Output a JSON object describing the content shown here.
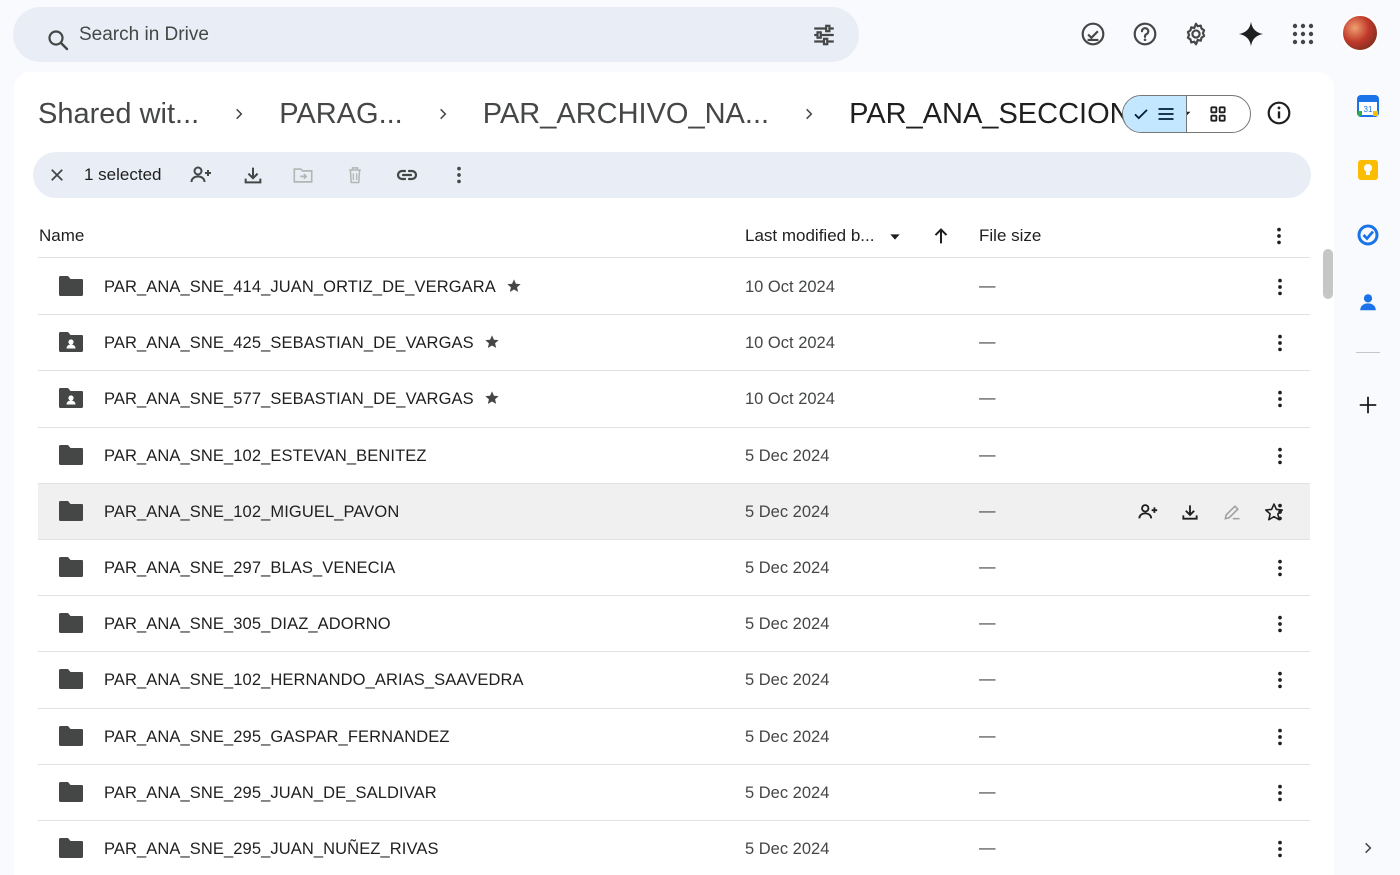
{
  "search": {
    "placeholder": "Search in Drive"
  },
  "top_icons": [
    "ready-for-offline-icon",
    "help-icon",
    "settings-icon",
    "gemini-spark-icon",
    "apps-grid-icon"
  ],
  "breadcrumb": [
    {
      "label": "Shared wit..."
    },
    {
      "label": "PARAG..."
    },
    {
      "label": "PAR_ARCHIVO_NA..."
    },
    {
      "label": "PAR_ANA_SECCION_..."
    }
  ],
  "view_toggle": {
    "selected": "list"
  },
  "selection_bar": {
    "count_label": "1 selected"
  },
  "table": {
    "headers": {
      "name": "Name",
      "modified": "Last modified b...",
      "size": "File size"
    },
    "rows": [
      {
        "name": "PAR_ANA_SNE_414_JUAN_ORTIZ_DE_VERGARA",
        "modified": "10 Oct 2024",
        "size": "—",
        "starred": true,
        "icon": "folder-icon"
      },
      {
        "name": "PAR_ANA_SNE_425_SEBASTIAN_DE_VARGAS",
        "modified": "10 Oct 2024",
        "size": "—",
        "starred": true,
        "icon": "shared-folder-icon"
      },
      {
        "name": "PAR_ANA_SNE_577_SEBASTIAN_DE_VARGAS",
        "modified": "10 Oct 2024",
        "size": "—",
        "starred": true,
        "icon": "shared-folder-icon"
      },
      {
        "name": "PAR_ANA_SNE_102_ESTEVAN_BENITEZ",
        "modified": "5 Dec 2024",
        "size": "—",
        "starred": false,
        "icon": "folder-icon"
      },
      {
        "name": "PAR_ANA_SNE_102_MIGUEL_PAVON",
        "modified": "5 Dec 2024",
        "size": "—",
        "starred": false,
        "icon": "folder-icon",
        "hovered": true
      },
      {
        "name": "PAR_ANA_SNE_297_BLAS_VENECIA",
        "modified": "5 Dec 2024",
        "size": "—",
        "starred": false,
        "icon": "folder-icon"
      },
      {
        "name": "PAR_ANA_SNE_305_DIAZ_ADORNO",
        "modified": "5 Dec 2024",
        "size": "—",
        "starred": false,
        "icon": "folder-icon"
      },
      {
        "name": "PAR_ANA_SNE_102_HERNANDO_ARIAS_SAAVEDRA",
        "modified": "5 Dec 2024",
        "size": "—",
        "starred": false,
        "icon": "folder-icon"
      },
      {
        "name": "PAR_ANA_SNE_295_GASPAR_FERNANDEZ",
        "modified": "5 Dec 2024",
        "size": "—",
        "starred": false,
        "icon": "folder-icon"
      },
      {
        "name": "PAR_ANA_SNE_295_JUAN_DE_SALDIVAR",
        "modified": "5 Dec 2024",
        "size": "—",
        "starred": false,
        "icon": "folder-icon"
      },
      {
        "name": "PAR_ANA_SNE_295_JUAN_NUÑEZ_RIVAS",
        "modified": "5 Dec 2024",
        "size": "—",
        "starred": false,
        "icon": "folder-icon"
      }
    ]
  },
  "side_panel": [
    "calendar-icon",
    "keep-icon",
    "tasks-icon",
    "contacts-icon",
    "add-icon",
    "expand-chevron-icon"
  ],
  "colors": {
    "accent": "#c2e7ff",
    "search_bg": "#e9eef6",
    "page_bg": "#f8fafd",
    "calendar_blue": "#1a73e8",
    "keep_yellow": "#fbbc04"
  }
}
